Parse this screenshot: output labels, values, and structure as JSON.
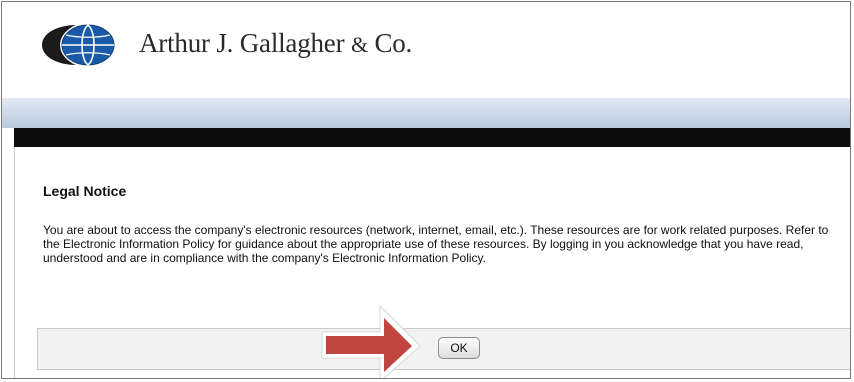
{
  "header": {
    "company_name": "Arthur J. Gallagher",
    "company_amp": "&",
    "company_suffix": "Co."
  },
  "notice": {
    "title": "Legal Notice",
    "body": "You are about to access the company's electronic resources (network, internet, email, etc.). These resources are for work related purposes. Refer to the Electronic Information Policy for guidance about the appropriate use of these resources. By logging in you acknowledge that you have read, understood and are in compliance with the company's Electronic Information Policy."
  },
  "actions": {
    "ok_label": "OK"
  },
  "colors": {
    "logo_blue": "#1a5aa8",
    "logo_dark": "#1b1b1b",
    "arrow_red": "#c0453f",
    "dark_bar": "#0b0b0b"
  },
  "icons": {
    "logo": "globe-logo-icon",
    "pointer": "right-arrow-icon"
  }
}
